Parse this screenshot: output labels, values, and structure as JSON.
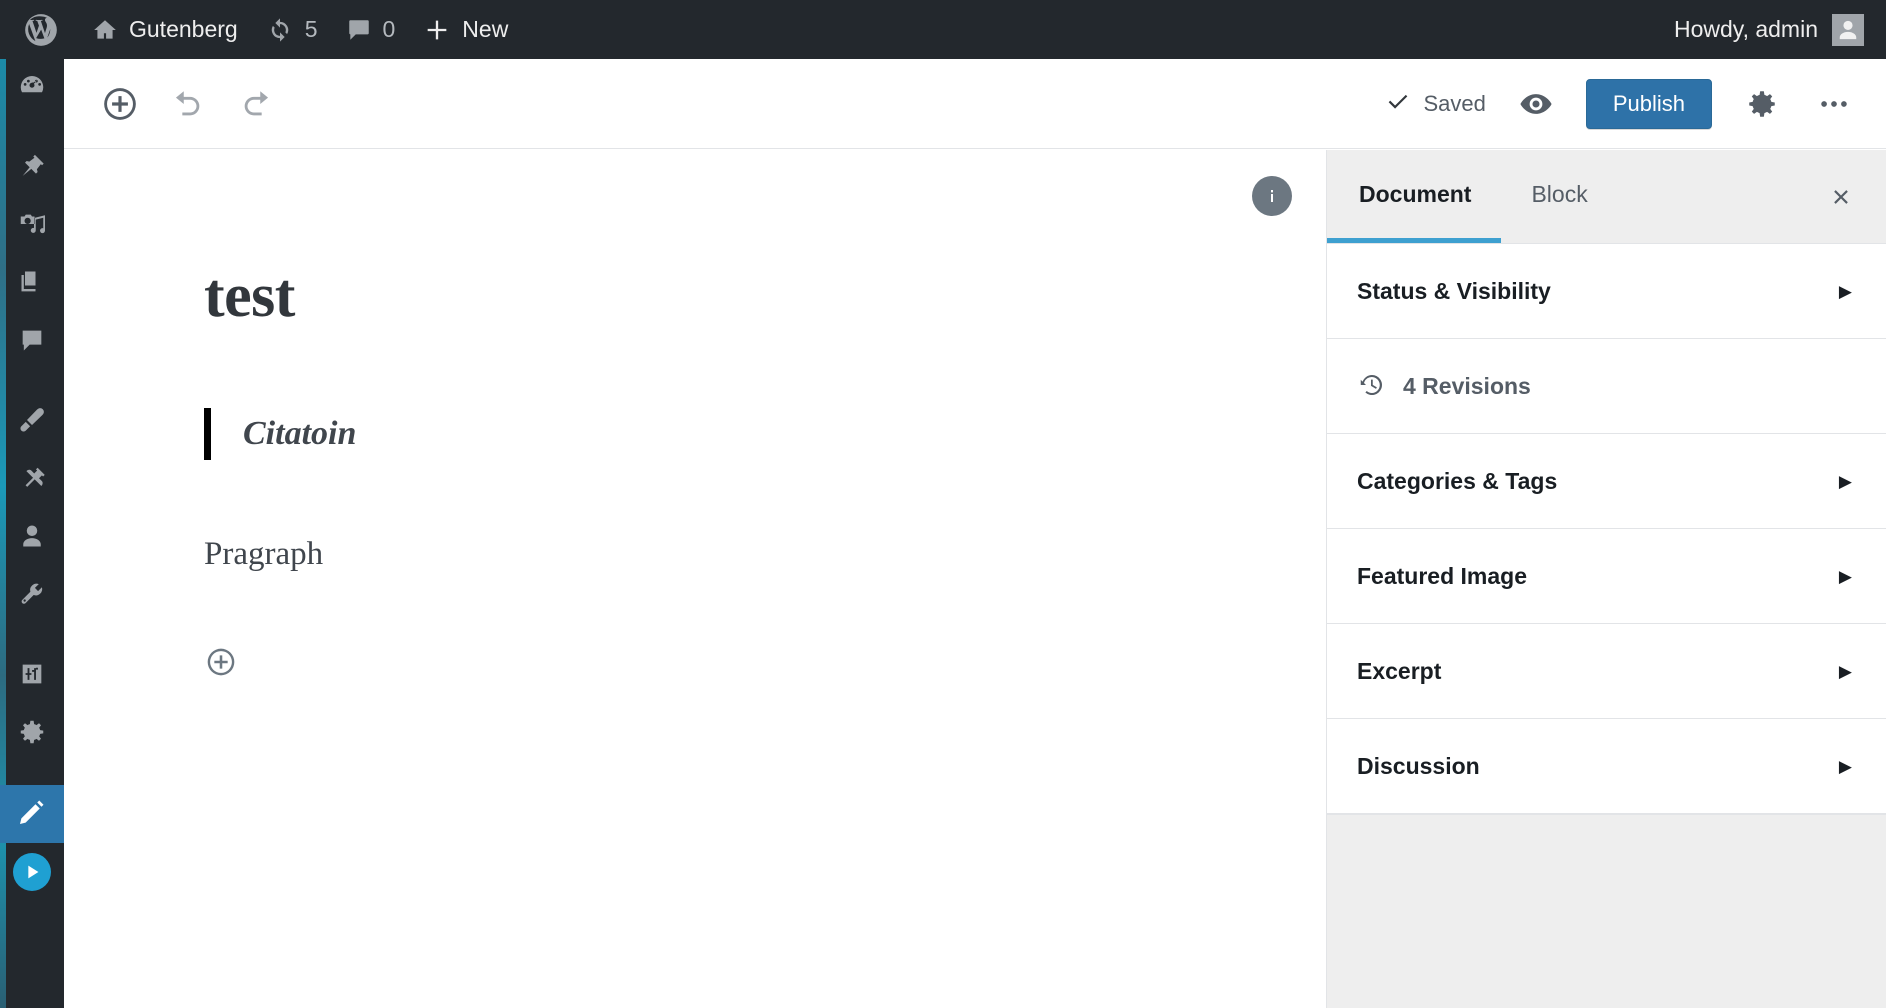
{
  "adminbar": {
    "wp_logo_label": "WordPress",
    "site_name": "Gutenberg",
    "updates_count": "5",
    "comments_count": "0",
    "new_label": "New",
    "howdy": "Howdy, admin"
  },
  "adminmenu": {
    "items": [
      {
        "name": "dashboard",
        "icon": "dashboard-icon"
      },
      {
        "name": "posts",
        "icon": "pin-icon"
      },
      {
        "name": "media",
        "icon": "media-icon"
      },
      {
        "name": "pages",
        "icon": "pages-icon"
      },
      {
        "name": "comments",
        "icon": "comment-icon"
      },
      {
        "name": "appearance",
        "icon": "brush-icon"
      },
      {
        "name": "plugins",
        "icon": "plug-icon"
      },
      {
        "name": "users",
        "icon": "user-icon"
      },
      {
        "name": "tools",
        "icon": "wrench-icon"
      },
      {
        "name": "settings-sliders",
        "icon": "sliders-icon"
      },
      {
        "name": "options",
        "icon": "gear-icon"
      },
      {
        "name": "gutenberg",
        "icon": "pencil-icon",
        "current": true
      },
      {
        "name": "media-player",
        "icon": "play-icon"
      }
    ]
  },
  "toolbar": {
    "add_block_label": "Add block",
    "undo_label": "Undo",
    "redo_label": "Redo",
    "saved_label": "Saved",
    "preview_label": "Preview",
    "publish_label": "Publish",
    "settings_label": "Settings",
    "more_label": "More options"
  },
  "editor": {
    "info_label": "Content structure",
    "title": "test",
    "blocks": [
      {
        "type": "quote",
        "text": "Citatoin"
      },
      {
        "type": "paragraph",
        "text": "Pragraph"
      }
    ],
    "inserter_label": "Add block"
  },
  "sidebar": {
    "tabs": [
      {
        "label": "Document",
        "active": true
      },
      {
        "label": "Block",
        "active": false
      }
    ],
    "close_label": "Close settings",
    "panels": [
      {
        "label": "Status & Visibility",
        "arrow": "▶"
      },
      {
        "label": "Categories & Tags",
        "arrow": "▶"
      },
      {
        "label": "Featured Image",
        "arrow": "▶"
      },
      {
        "label": "Excerpt",
        "arrow": "▶"
      },
      {
        "label": "Discussion",
        "arrow": "▶"
      }
    ],
    "revisions_label": "4 Revisions"
  },
  "colors": {
    "admin_dark": "#23282d",
    "accent_blue": "#2e72a8",
    "tab_underline": "#3ea0d0",
    "panel_border": "#e2e4e7",
    "sidebar_gray": "#eeeeee",
    "play_cyan": "#1fa0d2"
  }
}
